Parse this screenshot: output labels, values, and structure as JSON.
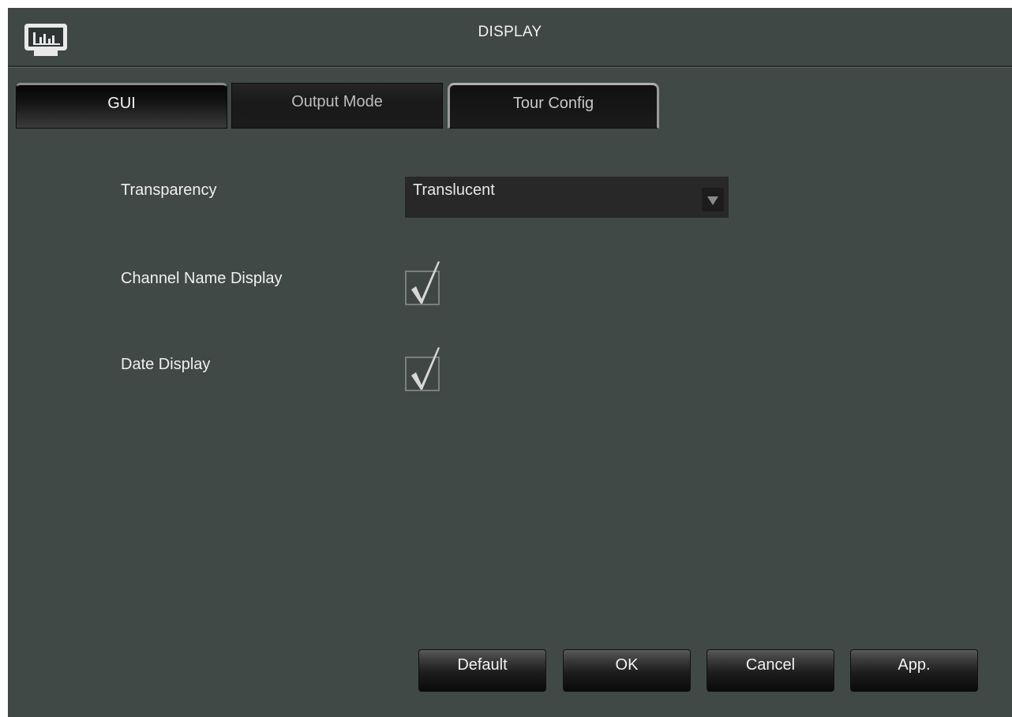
{
  "window": {
    "title": "DISPLAY",
    "icon": "monitor-chart-icon"
  },
  "tabs": [
    {
      "label": "GUI",
      "active": true
    },
    {
      "label": "Output Mode",
      "active": false
    },
    {
      "label": "Tour Config",
      "active": false
    }
  ],
  "settings": {
    "transparency": {
      "label": "Transparency",
      "value": "Translucent",
      "icon": "dropdown-arrow-icon"
    },
    "channel_name_display": {
      "label": "Channel Name Display",
      "checked": true
    },
    "date_display": {
      "label": "Date Display",
      "checked": true
    }
  },
  "buttons": {
    "default": "Default",
    "ok": "OK",
    "cancel": "Cancel",
    "apply": "App."
  },
  "colors": {
    "background": "#414947",
    "text": "#f0f0f0",
    "control_bg": "#282828"
  }
}
